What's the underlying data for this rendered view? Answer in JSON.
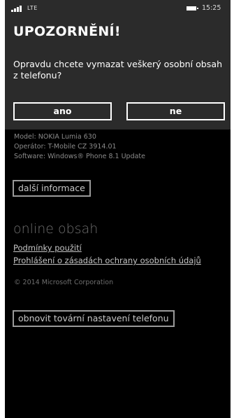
{
  "status": {
    "network": "LTE",
    "time": "15:25"
  },
  "dialog": {
    "title": "UPOZORNĚNÍ!",
    "message": "Opravdu chcete vymazat veškerý osobní obsah z telefonu?",
    "yes_label": "ano",
    "no_label": "ne"
  },
  "about": {
    "model": "Model: NOKIA Lumia 630",
    "operator": "Operátor: T-Mobile CZ 3914.01",
    "software": "Software: Windows® Phone 8.1 Update",
    "more_info_label": "další informace"
  },
  "online": {
    "title": "online obsah",
    "terms_link": "Podmínky použití",
    "privacy_link": "Prohlášení o zásadách ochrany osobních údajů",
    "copyright": "© 2014 Microsoft Corporation"
  },
  "reset_button_label": "obnovit tovární nastavení telefonu",
  "colors": {
    "dialog_background": "#2b2b2b",
    "page_background": "#000000",
    "text": "#ffffff"
  }
}
